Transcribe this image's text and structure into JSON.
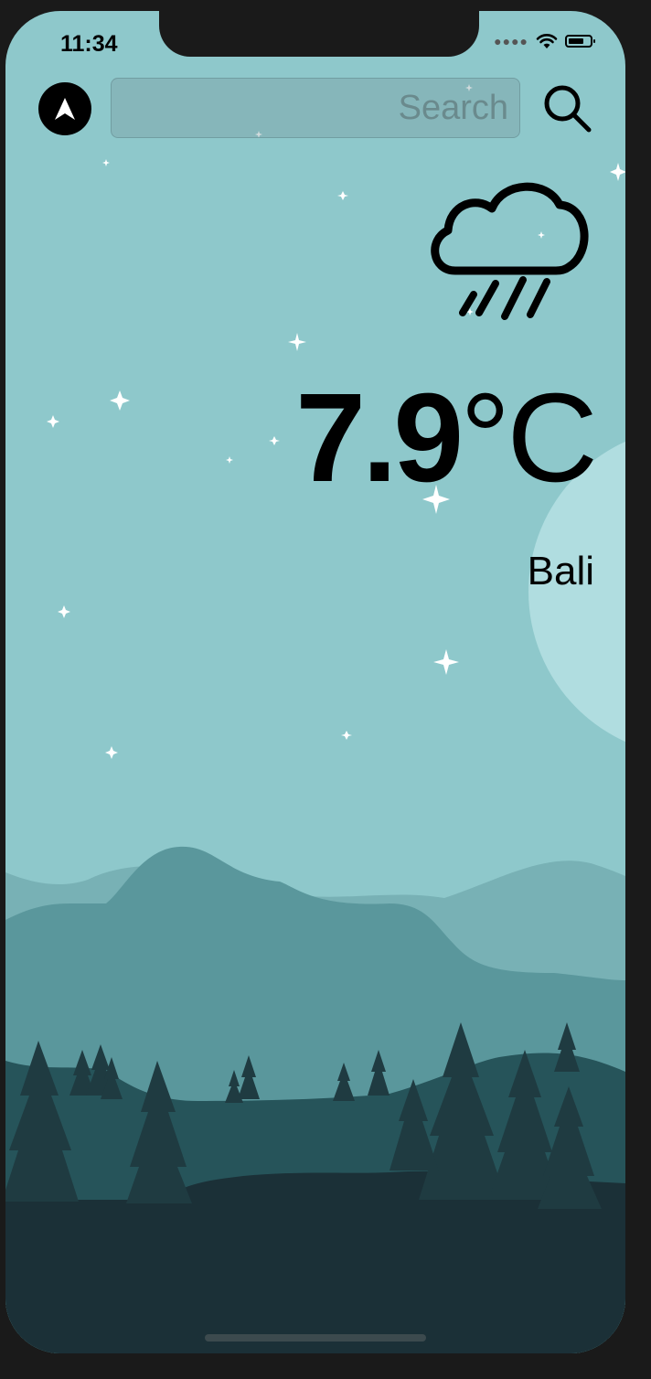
{
  "status_bar": {
    "time": "11:34",
    "signal_icon": "signal-dots-icon",
    "wifi_icon": "wifi-icon",
    "battery_icon": "battery-icon"
  },
  "header": {
    "location_button_icon": "location-arrow-icon",
    "search": {
      "value": "",
      "placeholder": "Search"
    },
    "search_button_icon": "search-icon"
  },
  "weather": {
    "condition_icon": "cloud-rain-icon",
    "temperature_value": "7.9",
    "temperature_unit": "°C",
    "city": "Bali"
  },
  "colors": {
    "sky": "#8ec8cb",
    "moon": "#b0dde0",
    "mountain_far": "#78b1b5",
    "mountain_mid": "#5a979c",
    "hills": "#26545a",
    "ground": "#1b3037",
    "trees": "#1f3b41",
    "text": "#000000"
  }
}
